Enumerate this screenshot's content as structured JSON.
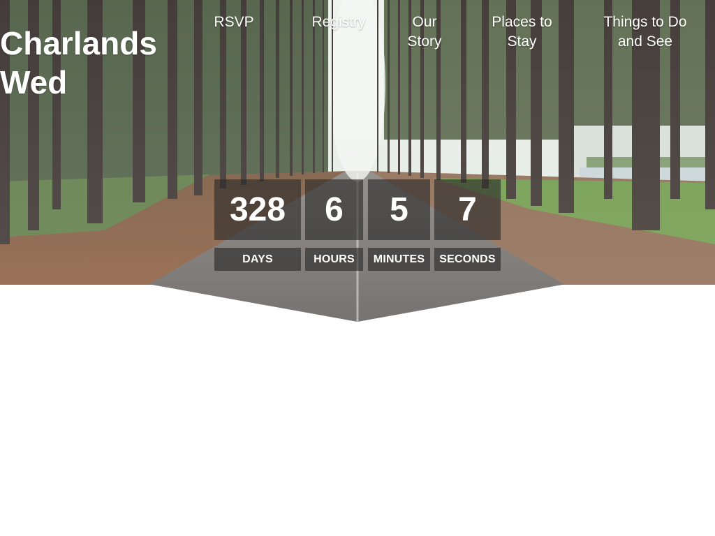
{
  "site": {
    "title": "Charlands Wed"
  },
  "nav": {
    "items": [
      {
        "label": "RSVP"
      },
      {
        "label": "Registry"
      },
      {
        "label": "Our Story"
      },
      {
        "label": "Places to Stay"
      },
      {
        "label": "Things to Do and See"
      }
    ]
  },
  "countdown": {
    "days": {
      "value": "328",
      "label": "DAYS"
    },
    "hours": {
      "value": "6",
      "label": "HOURS"
    },
    "minutes": {
      "value": "5",
      "label": "MINUTES"
    },
    "seconds": {
      "value": "7",
      "label": "SECONDS"
    }
  },
  "colors": {
    "overlay": "#282828",
    "text": "#ffffff",
    "page_background": "#ffffff"
  },
  "hero_image": "forest-road-photo"
}
